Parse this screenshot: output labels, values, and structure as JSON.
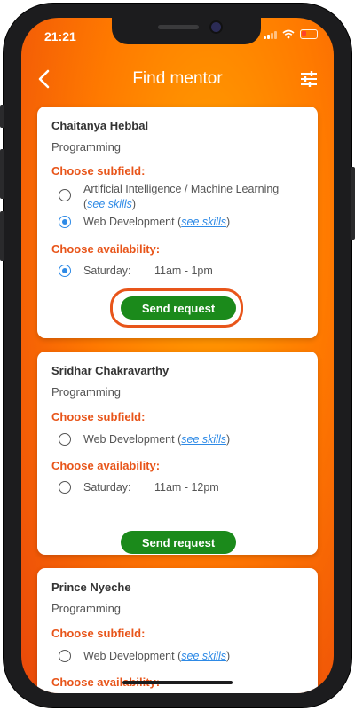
{
  "status_bar": {
    "time": "21:21"
  },
  "header": {
    "title": "Find mentor"
  },
  "subfield_heading": "Choose subfield:",
  "availability_heading": "Choose availability:",
  "link_label": "see skills",
  "send_label": "Send request",
  "mentors": [
    {
      "name": "Chaitanya Hebbal",
      "field": "Programming",
      "subfields": [
        {
          "line1": "Artificial Intelligence / Machine Learning",
          "prefix": "(",
          "suffix": ")",
          "selected": false
        },
        {
          "label": "Web Development",
          "prefix": "(",
          "suffix": ")",
          "selected": true
        }
      ],
      "availability": {
        "day": "Saturday:",
        "time": "11am - 1pm",
        "selected": true
      }
    },
    {
      "name": "Sridhar Chakravarthy",
      "field": "Programming",
      "subfields": [
        {
          "label": "Web Development",
          "prefix": "(",
          "suffix": ")",
          "selected": false
        }
      ],
      "availability": {
        "day": "Saturday:",
        "time": "11am - 12pm",
        "selected": false
      }
    },
    {
      "name": "Prince Nyeche",
      "field": "Programming",
      "subfields": [
        {
          "label": "Web Development",
          "prefix": "(",
          "suffix": ")",
          "selected": false
        }
      ],
      "availability": {
        "partial_heading": "Choose availability:"
      }
    }
  ],
  "colors": {
    "accent": "#e8551a",
    "button": "#1b8a1b",
    "link": "#2e8ae6",
    "background_gradient": "#ff7a00"
  }
}
